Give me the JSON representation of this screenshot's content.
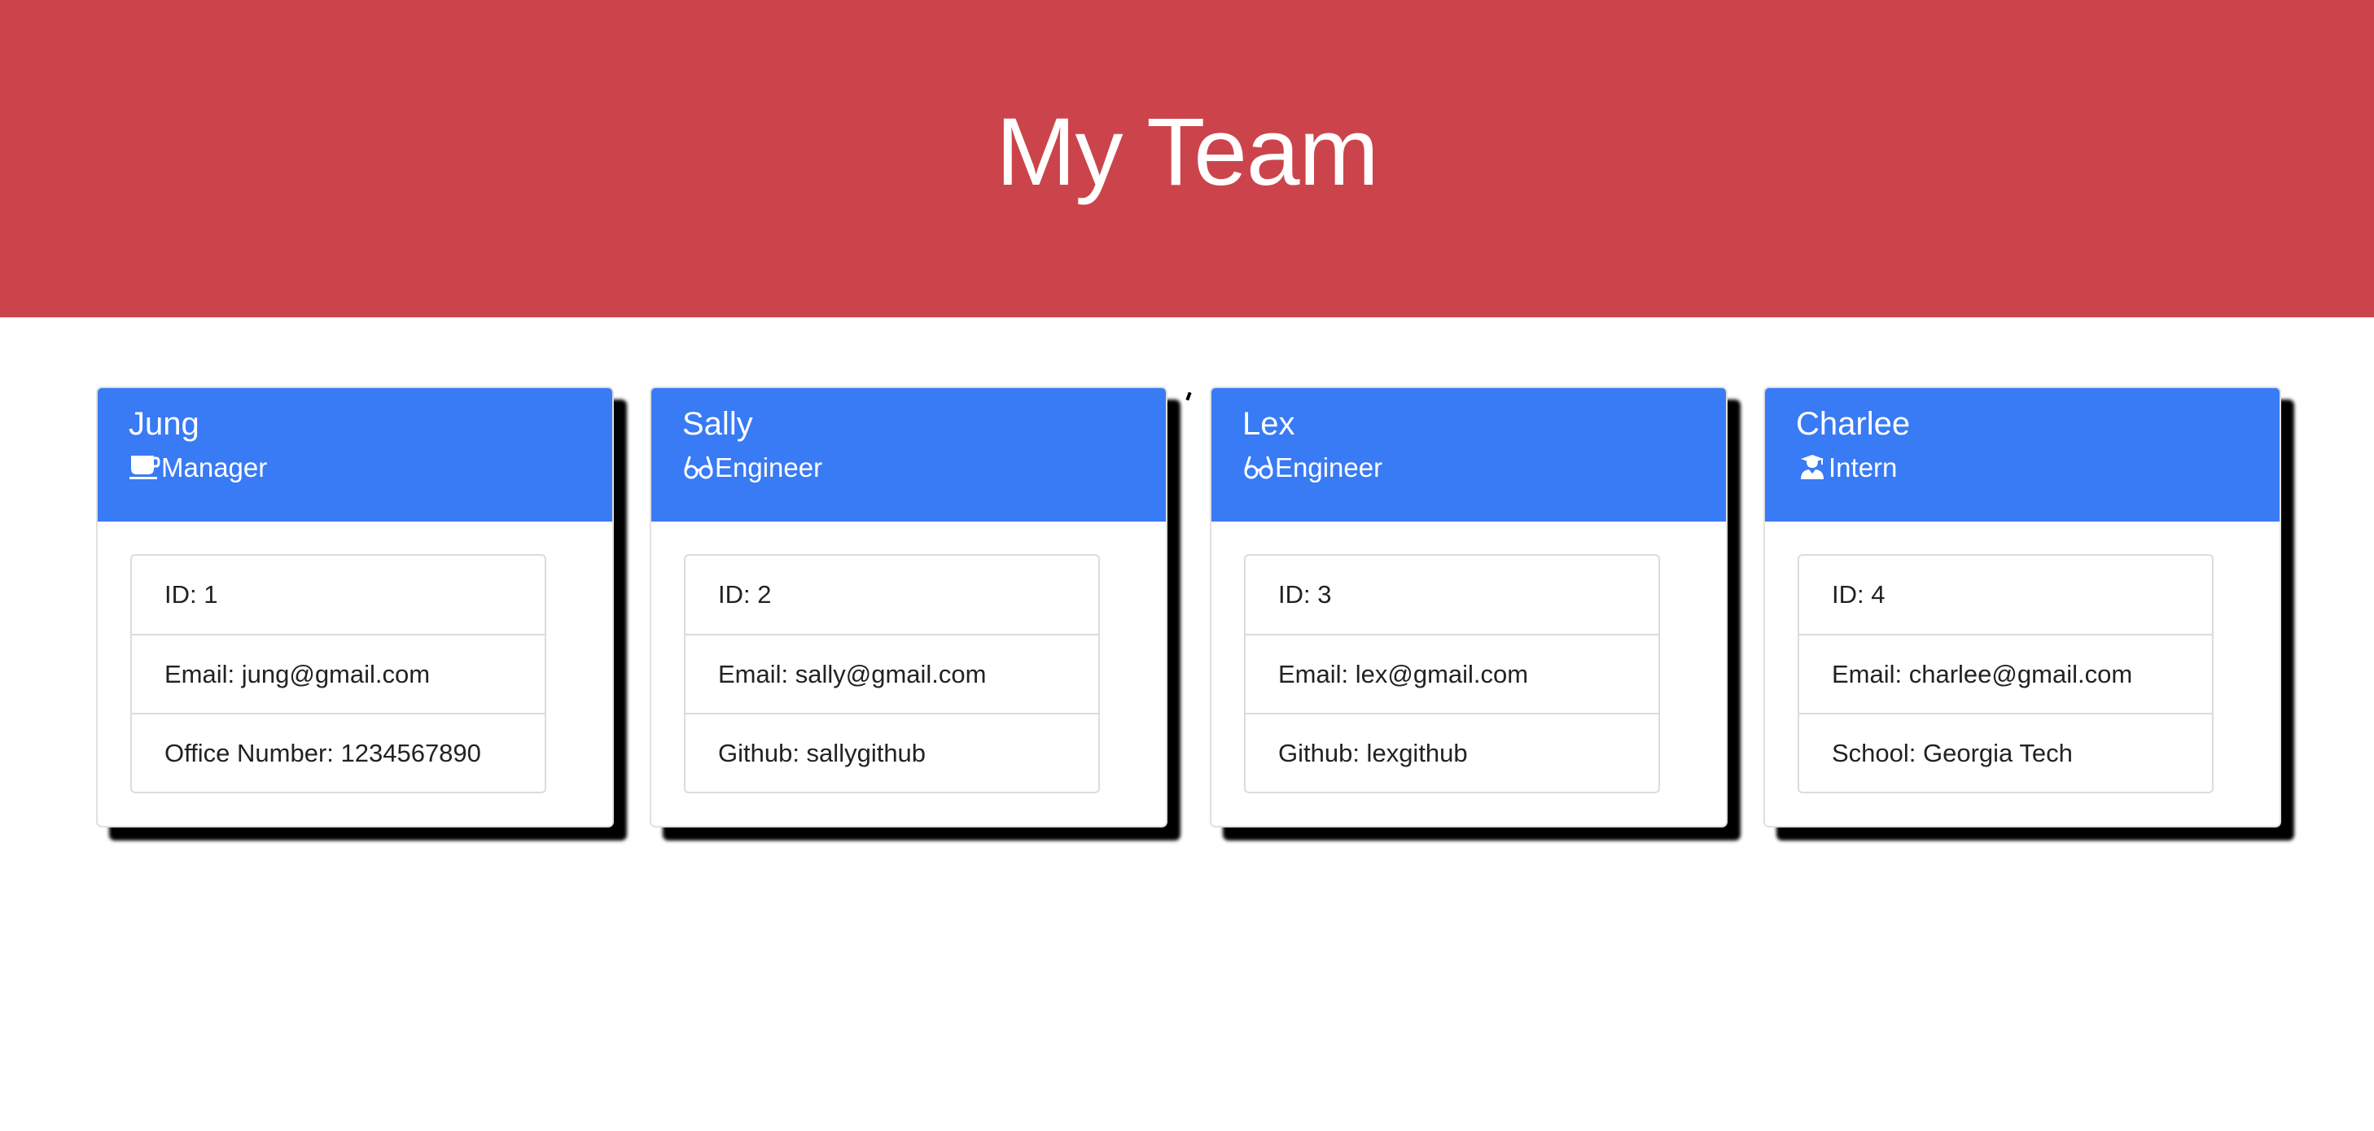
{
  "header": {
    "title": "My Team",
    "background": "#cc444b"
  },
  "colors": {
    "card_header": "#397af5",
    "shadow": "#000000"
  },
  "cards": [
    {
      "name": "Jung",
      "role": "Manager",
      "role_icon": "mug-icon",
      "details": [
        "ID: 1",
        "Email: jung@gmail.com",
        "Office Number: 1234567890"
      ]
    },
    {
      "name": "Sally",
      "role": "Engineer",
      "role_icon": "glasses-icon",
      "details": [
        "ID: 2",
        "Email: sally@gmail.com",
        "Github: sallygithub"
      ]
    },
    {
      "name": "Lex",
      "role": "Engineer",
      "role_icon": "glasses-icon",
      "details": [
        "ID: 3",
        "Email: lex@gmail.com",
        "Github: lexgithub"
      ]
    },
    {
      "name": "Charlee",
      "role": "Intern",
      "role_icon": "graduate-icon",
      "details": [
        "ID: 4",
        "Email: charlee@gmail.com",
        "School: Georgia Tech"
      ]
    }
  ]
}
